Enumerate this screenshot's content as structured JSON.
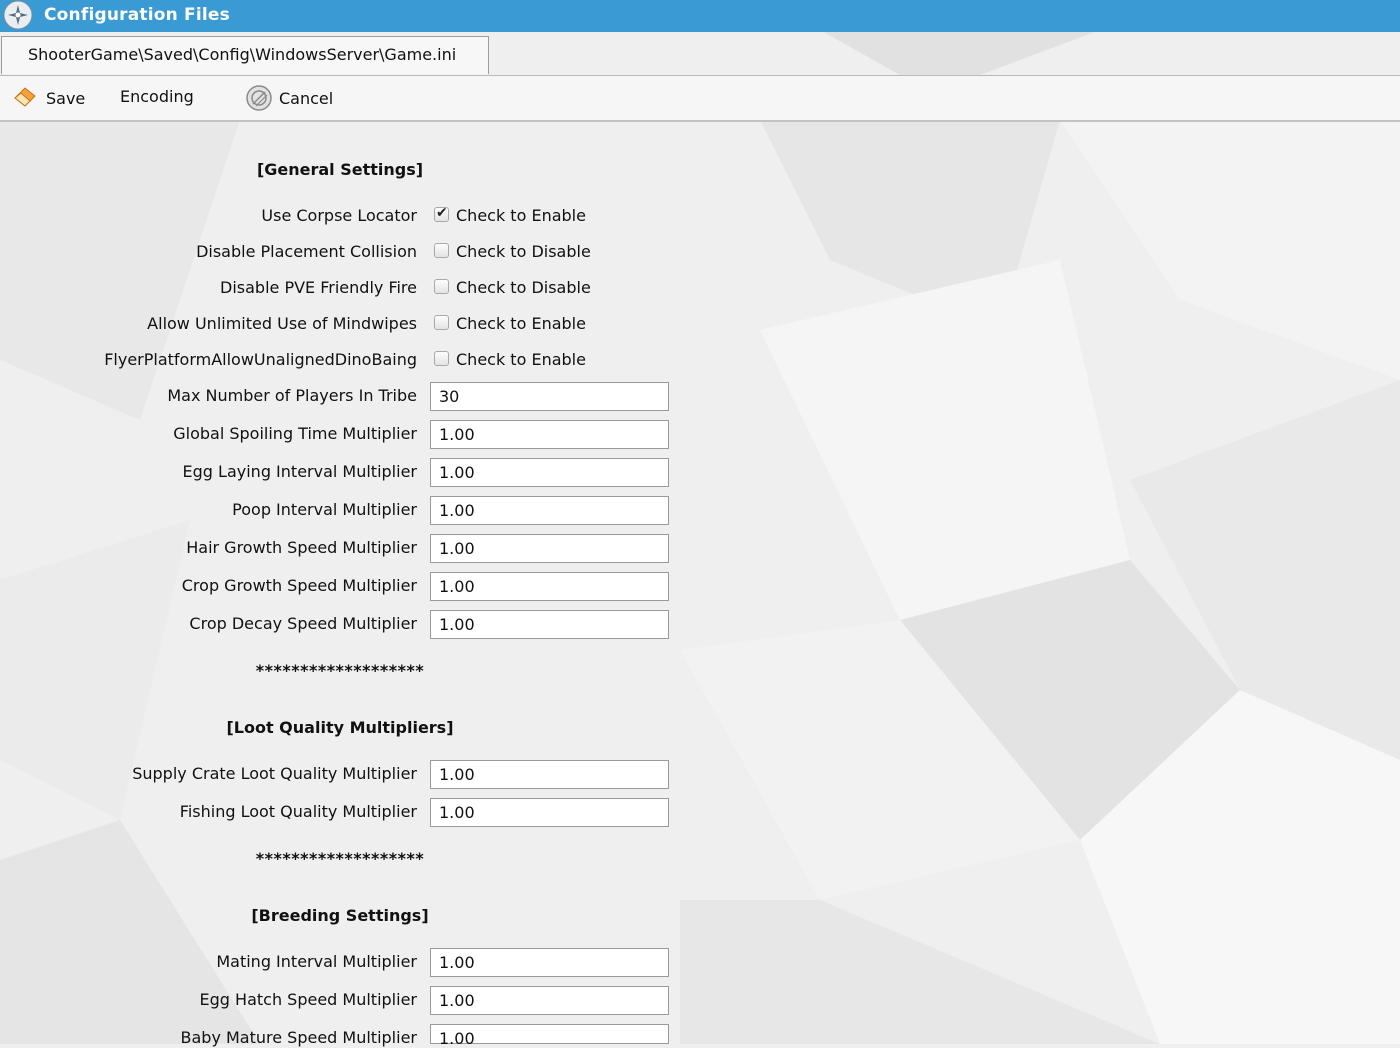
{
  "window": {
    "title": "Configuration Files",
    "title_icon": "gear-fan-icon",
    "accent_color": "#3a9ad3"
  },
  "tabs": [
    {
      "label": "ShooterGame\\Saved\\Config\\WindowsServer\\Game.ini",
      "active": true
    }
  ],
  "toolbar": {
    "save_label": "Save",
    "save_icon": "save-eraser-icon",
    "encoding_label": "Encoding",
    "cancel_label": "Cancel",
    "cancel_icon": "cancel-circle-icon"
  },
  "sections": {
    "general": {
      "heading": "[General Settings]",
      "checkboxes": [
        {
          "label": "Use Corpse Locator",
          "text": "Check to Enable",
          "checked": true
        },
        {
          "label": "Disable Placement Collision",
          "text": "Check to Disable",
          "checked": false
        },
        {
          "label": "Disable PVE Friendly Fire",
          "text": "Check to Disable",
          "checked": false
        },
        {
          "label": "Allow Unlimited Use of Mindwipes",
          "text": "Check to Enable",
          "checked": false
        },
        {
          "label": "FlyerPlatformAllowUnalignedDinoBaing",
          "text": "Check to Enable",
          "checked": false
        }
      ],
      "fields": [
        {
          "label": "Max Number of Players In Tribe",
          "value": "30"
        },
        {
          "label": "Global Spoiling Time Multiplier",
          "value": "1.00"
        },
        {
          "label": "Egg Laying Interval Multiplier",
          "value": "1.00"
        },
        {
          "label": "Poop Interval Multiplier",
          "value": "1.00"
        },
        {
          "label": "Hair Growth Speed Multiplier",
          "value": "1.00"
        },
        {
          "label": "Crop Growth Speed Multiplier",
          "value": "1.00"
        },
        {
          "label": "Crop Decay Speed Multiplier",
          "value": "1.00"
        }
      ],
      "separator": "*******************"
    },
    "loot": {
      "heading": "[Loot Quality Multipliers]",
      "fields": [
        {
          "label": "Supply Crate Loot Quality Multiplier",
          "value": "1.00"
        },
        {
          "label": "Fishing Loot Quality Multiplier",
          "value": "1.00"
        }
      ],
      "separator": "*******************"
    },
    "breeding": {
      "heading": "[Breeding Settings]",
      "fields": [
        {
          "label": "Mating Interval Multiplier",
          "value": "1.00"
        },
        {
          "label": "Egg Hatch Speed Multiplier",
          "value": "1.00"
        },
        {
          "label": "Baby Mature Speed Multiplier",
          "value": "1.00"
        }
      ]
    }
  }
}
